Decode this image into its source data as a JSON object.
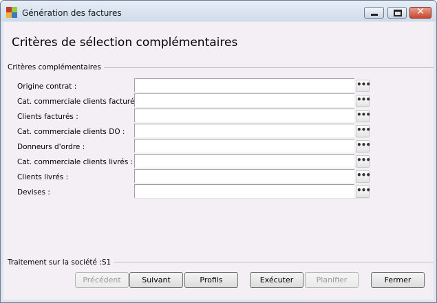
{
  "window": {
    "title": "Génération des factures"
  },
  "page": {
    "heading": "Critères de sélection complémentaires",
    "group_label": "Critères complémentaires"
  },
  "fields": [
    {
      "label": "Origine contrat :",
      "value": ""
    },
    {
      "label": "Cat. commerciale clients facturés :",
      "value": ""
    },
    {
      "label": "Clients facturés :",
      "value": ""
    },
    {
      "label": "Cat. commerciale clients DO :",
      "value": ""
    },
    {
      "label": "Donneurs d'ordre :",
      "value": ""
    },
    {
      "label": "Cat. commerciale clients livrés :",
      "value": ""
    },
    {
      "label": "Clients livrés :",
      "value": ""
    },
    {
      "label": "Devises :",
      "value": ""
    }
  ],
  "lookup_glyph": "•••",
  "status": {
    "text": "Traitement sur la société :S1"
  },
  "buttons": {
    "previous": "Précédent",
    "next": "Suivant",
    "profiles": "Profils",
    "execute": "Exécuter",
    "schedule": "Planifier",
    "close": "Fermer"
  },
  "caption_buttons": {
    "close_glyph": "✕"
  }
}
